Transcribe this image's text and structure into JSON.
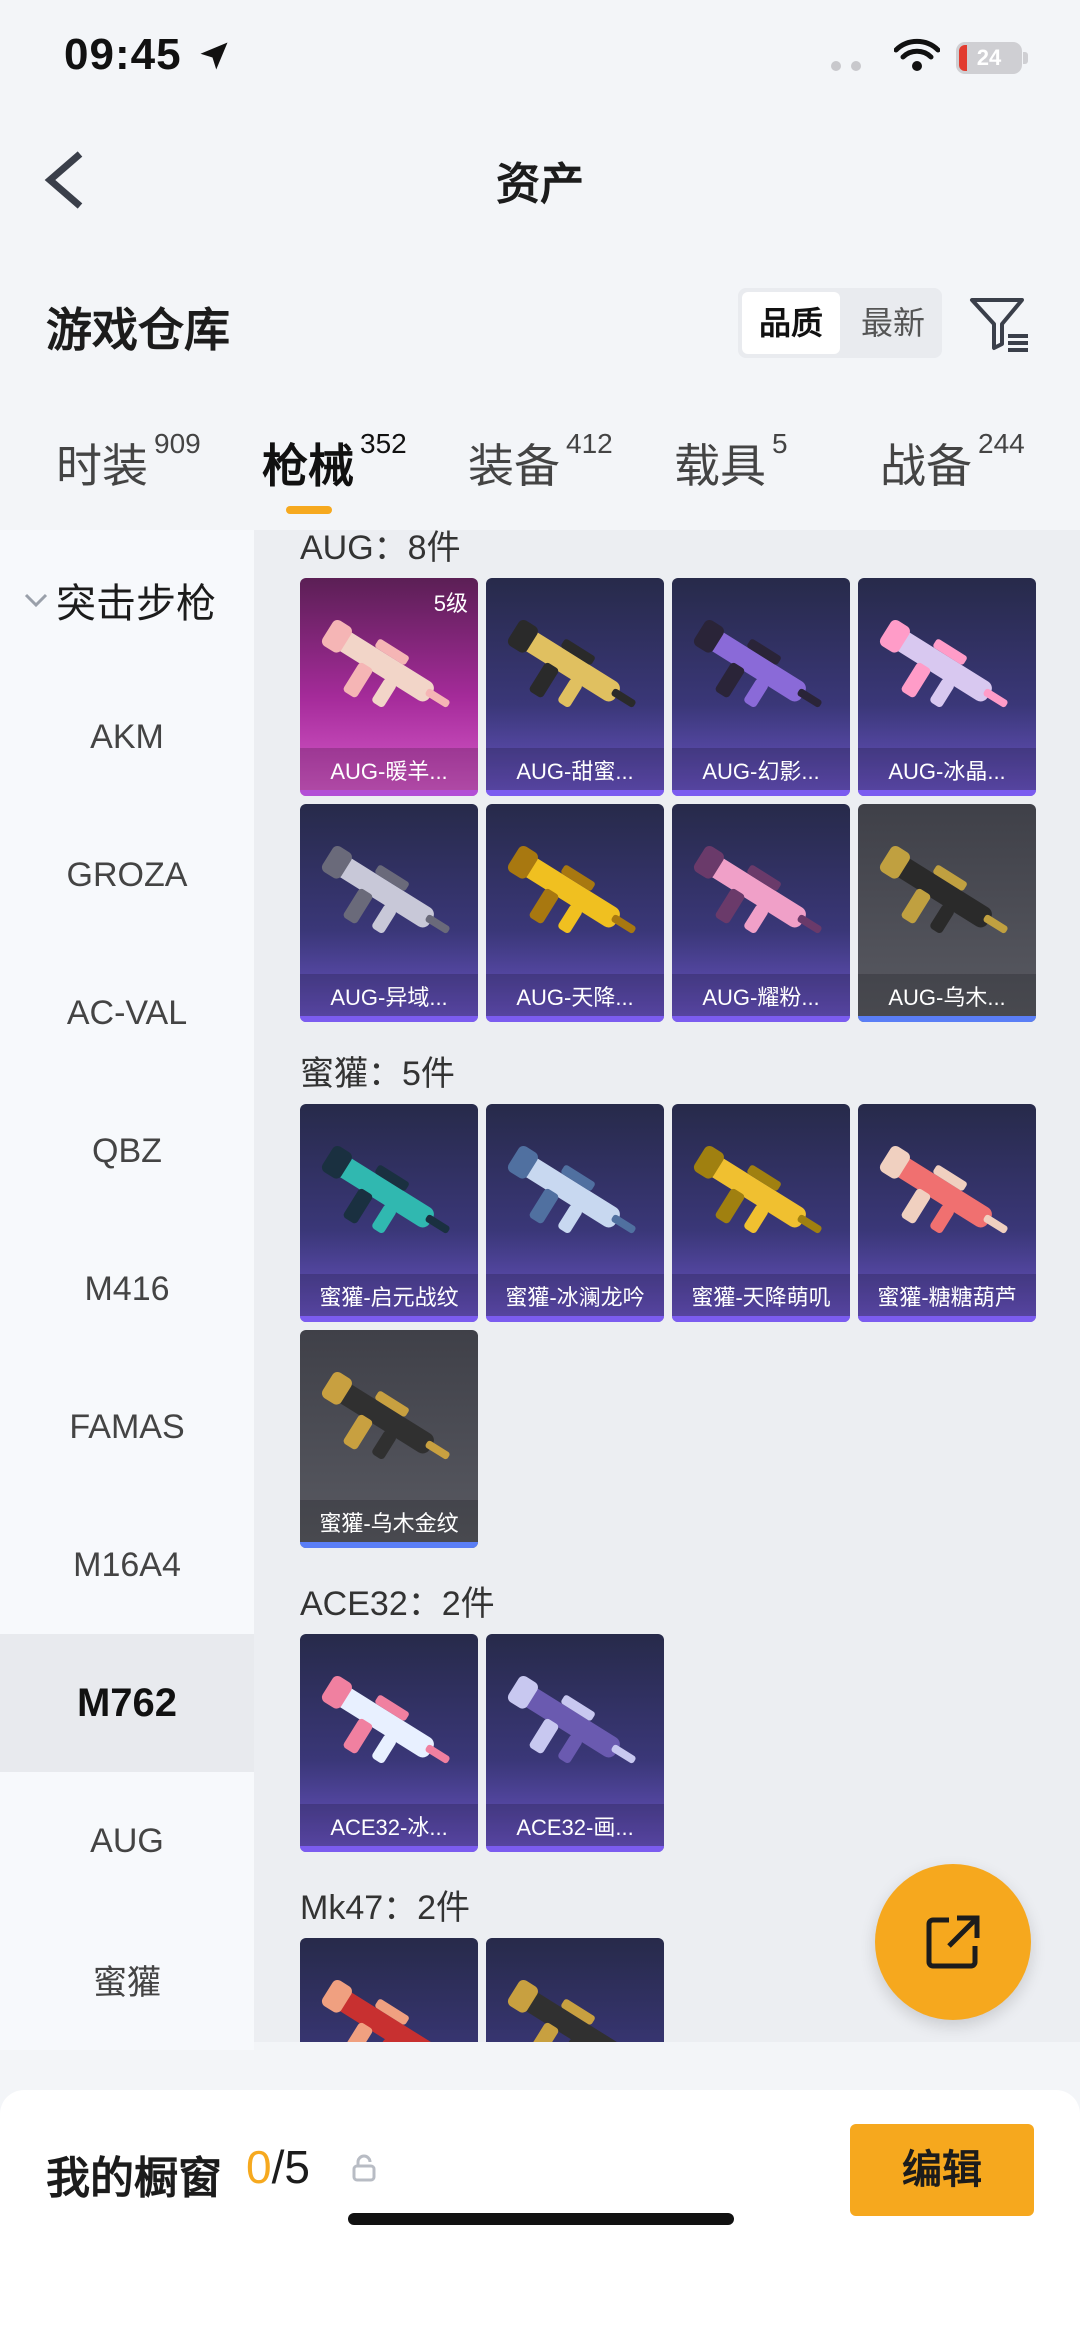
{
  "status_bar": {
    "time": "09:45",
    "battery": "24"
  },
  "header": {
    "title": "资产"
  },
  "warehouse": {
    "title": "游戏仓库",
    "sort_options": [
      "品质",
      "最新"
    ]
  },
  "category_tabs": [
    {
      "label": "时装",
      "count": "909"
    },
    {
      "label": "枪械",
      "count": "352"
    },
    {
      "label": "装备",
      "count": "412"
    },
    {
      "label": "载具",
      "count": "5"
    },
    {
      "label": "战备",
      "count": "244"
    }
  ],
  "sidebar": {
    "group": "突击步枪",
    "items": [
      "AKM",
      "GROZA",
      "AC-VAL",
      "QBZ",
      "M416",
      "FAMAS",
      "M16A4",
      "M762",
      "AUG",
      "蜜獾"
    ]
  },
  "groups": [
    {
      "header": "AUG：8件",
      "items": [
        {
          "name": "AUG-暖羊...",
          "level": "5级"
        },
        {
          "name": "AUG-甜蜜..."
        },
        {
          "name": "AUG-幻影..."
        },
        {
          "name": "AUG-冰晶..."
        },
        {
          "name": "AUG-异域..."
        },
        {
          "name": "AUG-天降..."
        },
        {
          "name": "AUG-耀粉..."
        },
        {
          "name": "AUG-乌木..."
        }
      ]
    },
    {
      "header": "蜜獾：5件",
      "items": [
        {
          "name": "蜜獾-启元战纹"
        },
        {
          "name": "蜜獾-冰澜龙吟"
        },
        {
          "name": "蜜獾-天降萌叽"
        },
        {
          "name": "蜜獾-糖糖葫芦"
        },
        {
          "name": "蜜獾-乌木金纹"
        }
      ]
    },
    {
      "header": "ACE32：2件",
      "items": [
        {
          "name": "ACE32-冰..."
        },
        {
          "name": "ACE32-画..."
        }
      ]
    },
    {
      "header": "Mk47：2件",
      "items": [
        {
          "name": ""
        },
        {
          "name": ""
        }
      ]
    }
  ],
  "showcase": {
    "label": "我的橱窗",
    "current": "0",
    "total": "/5"
  },
  "edit_button": "编辑",
  "colors": {
    "accent": "#f6a81e",
    "card_purple": "#3a3778",
    "card_pink": "#a52b9a",
    "card_gray": "#4f5058"
  }
}
